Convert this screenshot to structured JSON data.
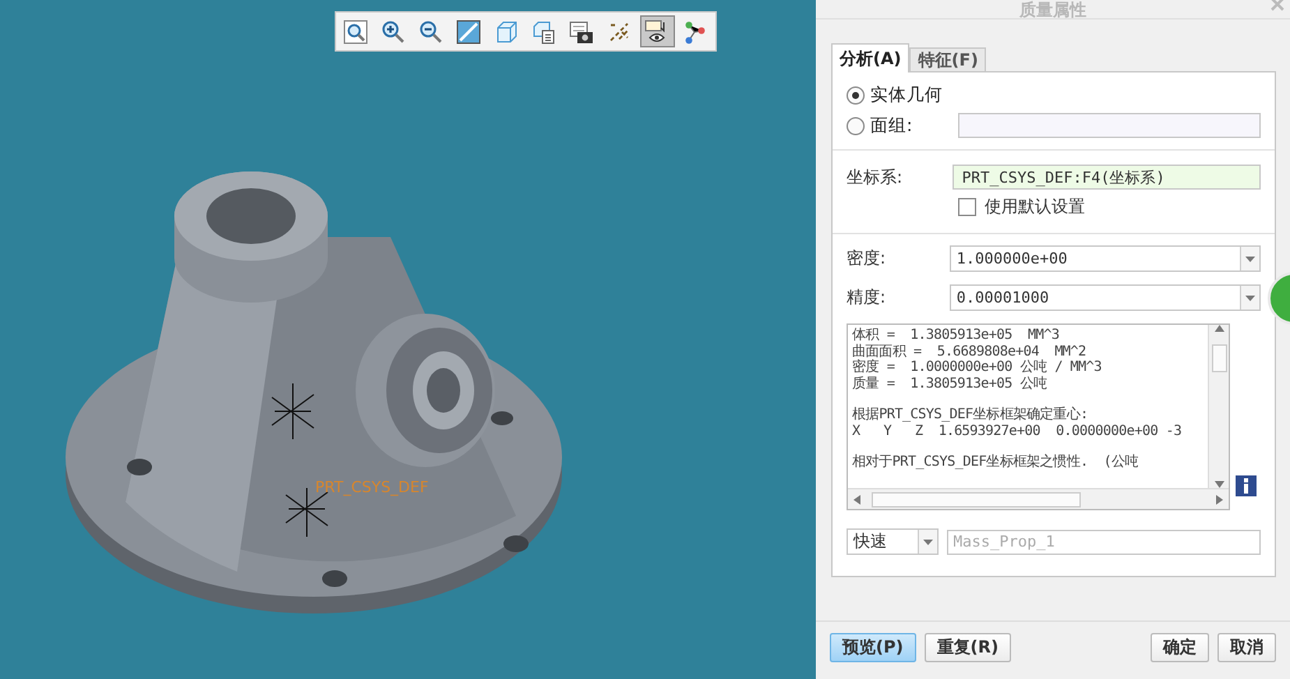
{
  "viewport": {
    "csys_label": "PRT_CSYS_DEF",
    "toolbar": [
      {
        "kind": "zoom-window",
        "selected": false
      },
      {
        "kind": "zoom-in",
        "selected": false
      },
      {
        "kind": "zoom-out",
        "selected": false
      },
      {
        "kind": "repaint",
        "selected": false
      },
      {
        "kind": "display-style",
        "selected": false
      },
      {
        "kind": "saved-views",
        "selected": false
      },
      {
        "kind": "view-manager",
        "selected": false
      },
      {
        "kind": "datum-display",
        "selected": false
      },
      {
        "kind": "annotation-display",
        "selected": true
      },
      {
        "kind": "spin-center",
        "selected": false
      }
    ]
  },
  "dialog": {
    "title": "质量属性",
    "tabs": [
      {
        "label": "分析(A)",
        "selected": true
      },
      {
        "label": "特征(F)",
        "selected": false
      }
    ],
    "geometry_options": [
      {
        "label": "实体几何",
        "selected": true
      },
      {
        "label": "面组:",
        "selected": false
      }
    ],
    "coordinate_system": {
      "label": "坐标系:",
      "value": "PRT_CSYS_DEF:F4(坐标系)"
    },
    "use_default": {
      "label": "使用默认设置",
      "checked": false
    },
    "density": {
      "label": "密度:",
      "value": "1.000000e+00"
    },
    "precision": {
      "label": "精度:",
      "value": "0.00001000"
    },
    "result_groups": [
      [
        "体积 =  1.3805913e+05  MM^3",
        "曲面面积 =  5.6689808e+04  MM^2",
        "密度 =  1.0000000e+00 公吨 / MM^3",
        "质量 =  1.3805913e+05 公吨"
      ],
      [
        "根据PRT_CSYS_DEF坐标框架确定重心:",
        "X   Y   Z  1.6593927e+00  0.0000000e+00 -3"
      ],
      [
        "相对于PRT_CSYS_DEF坐标框架之惯性.  (公吨"
      ]
    ],
    "mode": {
      "value": "快速"
    },
    "name_field": {
      "placeholder": "Mass_Prop_1"
    },
    "buttons": [
      {
        "label": "预览(P)",
        "kind": "primary"
      },
      {
        "label": "重复(R)",
        "kind": "normal"
      },
      {
        "label": "确定",
        "kind": "normal"
      },
      {
        "label": "取消",
        "kind": "normal"
      }
    ]
  }
}
